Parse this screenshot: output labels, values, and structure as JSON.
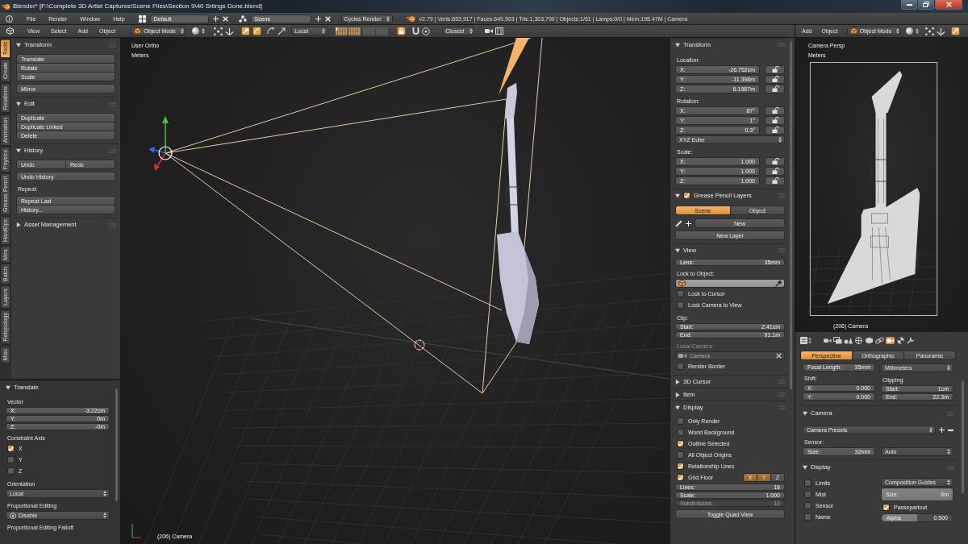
{
  "window": {
    "title": "Blender* [F:\\Complete 3D Artist Captures\\Scene Files\\Section 9\\40 Srtings Done.blend]"
  },
  "info_header": {
    "menus": [
      "File",
      "Render",
      "Window",
      "Help"
    ],
    "screen_layout": "Default",
    "scene": "Scene",
    "render_engine": "Cycles Render",
    "stats": "v2.79 | Verts:653,917 | Faces:649,903 | Tris:1,303,790 | Objects:1/61 | Lamps:0/0 | Mem:195.47M | Camera"
  },
  "viewport_header": {
    "menus": [
      "View",
      "Select",
      "Add",
      "Object"
    ],
    "mode": "Object Mode",
    "orientation": "Local",
    "snap_target": "Closest"
  },
  "camera_view_header": {
    "menus": [
      "Add",
      "Object"
    ],
    "mode": "Object Mode"
  },
  "tool_shelf": {
    "tabs": [
      {
        "label": "Tools",
        "selected": true
      },
      {
        "label": "Create",
        "selected": false
      },
      {
        "label": "Relations",
        "selected": false
      },
      {
        "label": "Animation",
        "selected": false
      },
      {
        "label": "Physics",
        "selected": false
      },
      {
        "label": "Grease Pencil",
        "selected": false
      },
      {
        "label": "HardOps",
        "selected": false
      },
      {
        "label": "Mira",
        "selected": false
      },
      {
        "label": "Batch",
        "selected": false
      },
      {
        "label": "Layers",
        "selected": false
      },
      {
        "label": "Retopology",
        "selected": false
      },
      {
        "label": "Misc",
        "selected": false
      }
    ],
    "panels": [
      {
        "title": "Transform",
        "expanded": true,
        "rows": [
          {
            "kind": "buttons",
            "labels": [
              "Translate",
              "Rotate",
              "Scale"
            ]
          },
          {
            "kind": "buttons",
            "labels": [
              "Mirror"
            ]
          }
        ]
      },
      {
        "title": "Edit",
        "expanded": true,
        "rows": [
          {
            "kind": "buttons",
            "labels": [
              "Duplicate",
              "Duplicate Linked",
              "Delete"
            ]
          }
        ]
      },
      {
        "title": "History",
        "expanded": true,
        "rows": [
          {
            "kind": "button_row",
            "labels": [
              "Undo",
              "Redo"
            ]
          },
          {
            "kind": "buttons",
            "labels": [
              "Undo History"
            ]
          },
          {
            "kind": "label",
            "text": "Repeat:"
          },
          {
            "kind": "buttons",
            "labels": [
              "Repeat Last",
              "History..."
            ]
          }
        ]
      },
      {
        "title": "Asset Management",
        "expanded": false
      }
    ]
  },
  "operator_panel": {
    "title": "Translate",
    "expanded": true,
    "rows": [
      {
        "kind": "label",
        "text": "Vector"
      },
      {
        "kind": "number",
        "label": "X:",
        "value": "-3.22cm"
      },
      {
        "kind": "number",
        "label": "Y:",
        "value": "0m"
      },
      {
        "kind": "number",
        "label": "Z:",
        "value": "-0m"
      },
      {
        "kind": "label",
        "text": "Constraint Axis"
      },
      {
        "kind": "checkbox",
        "label": "X",
        "checked": true
      },
      {
        "kind": "checkbox",
        "label": "Y",
        "checked": false
      },
      {
        "kind": "checkbox",
        "label": "Z",
        "checked": false
      },
      {
        "kind": "label",
        "text": "Orientation"
      },
      {
        "kind": "dropdown",
        "value": "Local"
      },
      {
        "kind": "label",
        "text": "Proportional Editing"
      },
      {
        "kind": "icon_dropdown",
        "value": "Disable"
      },
      {
        "kind": "label",
        "text": "Proportional Editing Falloff"
      }
    ]
  },
  "viewport": {
    "view_name": "User Ortho",
    "units": "Meters",
    "object_info": "(206) Camera"
  },
  "sidebar": {
    "panels": [
      {
        "title": "Transform",
        "expanded": true,
        "rows": [
          {
            "kind": "label",
            "text": "Location:"
          },
          {
            "kind": "number",
            "label": "X:",
            "value": "-26.752cm",
            "locked": false
          },
          {
            "kind": "number",
            "label": "Y:",
            "value": "-11.398m",
            "locked": false
          },
          {
            "kind": "number",
            "label": "Z:",
            "value": "6.1987m",
            "locked": false
          },
          {
            "kind": "label",
            "text": "Rotation:"
          },
          {
            "kind": "number",
            "label": "X:",
            "value": "87°",
            "locked": false
          },
          {
            "kind": "number",
            "label": "Y:",
            "value": "1°",
            "locked": false
          },
          {
            "kind": "number",
            "label": "Z:",
            "value": "0.3°",
            "locked": false
          },
          {
            "kind": "dropdown",
            "value": "XYZ Euler"
          },
          {
            "kind": "label",
            "text": "Scale:"
          },
          {
            "kind": "number",
            "label": "X:",
            "value": "1.000",
            "locked": false
          },
          {
            "kind": "number",
            "label": "Y:",
            "value": "1.000",
            "locked": false
          },
          {
            "kind": "number",
            "label": "Z:",
            "value": "1.000",
            "locked": false
          }
        ]
      },
      {
        "title": "Grease Pencil Layers",
        "expanded": true,
        "enabled": true,
        "rows": [
          {
            "kind": "tabs",
            "items": [
              {
                "label": "Scene",
                "selected": true
              },
              {
                "label": "Object",
                "selected": false
              }
            ]
          },
          {
            "kind": "new_row",
            "label": "New"
          },
          {
            "kind": "buttons",
            "labels": [
              "New Layer"
            ]
          }
        ]
      },
      {
        "title": "View",
        "expanded": true,
        "rows": [
          {
            "kind": "number",
            "label": "Lens:",
            "value": "35mm"
          },
          {
            "kind": "label",
            "text": "Lock to Object:",
            "disabled": false
          },
          {
            "kind": "object_picker"
          },
          {
            "kind": "checkbox",
            "label": "Lock to Cursor",
            "checked": false
          },
          {
            "kind": "checkbox",
            "label": "Lock Camera to View",
            "checked": false
          },
          {
            "kind": "label",
            "text": "Clip:",
            "disabled": false
          },
          {
            "kind": "number",
            "label": "Start:",
            "value": "2.41cm"
          },
          {
            "kind": "number",
            "label": "End:",
            "value": "91.1m"
          },
          {
            "kind": "label",
            "text": "Local Camera:",
            "disabled": true
          },
          {
            "kind": "camera_field",
            "value": "Camera",
            "disabled": true
          },
          {
            "kind": "checkbox",
            "label": "Render Border",
            "checked": false
          }
        ]
      },
      {
        "title": "3D Cursor",
        "expanded": false
      },
      {
        "title": "Item",
        "expanded": false
      },
      {
        "title": "Display",
        "expanded": true,
        "rows": [
          {
            "kind": "checkbox",
            "label": "Only Render",
            "checked": false
          },
          {
            "kind": "checkbox",
            "label": "World Background",
            "checked": false
          },
          {
            "kind": "checkbox",
            "label": "Outline Selected",
            "checked": true
          },
          {
            "kind": "checkbox",
            "label": "All Object Origins",
            "checked": false
          },
          {
            "kind": "checkbox",
            "label": "Relationship Lines",
            "checked": true
          },
          {
            "kind": "grid_floor",
            "label": "Grid Floor",
            "checked": true,
            "axes": [
              {
                "label": "X",
                "selected": true
              },
              {
                "label": "Y",
                "selected": true
              },
              {
                "label": "Z",
                "selected": false
              }
            ]
          },
          {
            "kind": "number",
            "label": "Lines:",
            "value": "16",
            "disabled": false
          },
          {
            "kind": "number",
            "label": "Scale:",
            "value": "1.000",
            "disabled": false
          },
          {
            "kind": "number",
            "label": "Subdivisions:",
            "value": "10",
            "disabled": true
          },
          {
            "kind": "buttons",
            "labels": [
              "Toggle Quad View"
            ]
          }
        ]
      }
    ]
  },
  "camera_view": {
    "view_name": "Camera Persp",
    "units": "Meters",
    "object_info": "(206) Camera"
  },
  "camera_properties": {
    "context_tabs": [
      {
        "selected": false
      },
      {
        "selected": false
      },
      {
        "selected": false
      },
      {
        "selected": false
      },
      {
        "selected": false
      },
      {
        "selected": false
      },
      {
        "selected": true
      },
      {
        "selected": false
      },
      {
        "selected": false
      }
    ],
    "lens_types": [
      {
        "label": "Perspective",
        "selected": true
      },
      {
        "label": "Orthographic",
        "selected": false
      },
      {
        "label": "Panoramic",
        "selected": false
      }
    ],
    "lens_rows": [
      {
        "kind": "columns",
        "left": [
          {
            "kind": "number",
            "label": "Focal Length:",
            "value": "35mm"
          },
          {
            "kind": "label",
            "text": "Shift:"
          },
          {
            "kind": "number",
            "label": "X:",
            "value": "0.000"
          },
          {
            "kind": "number",
            "label": "Y:",
            "value": "0.000"
          }
        ],
        "right": [
          {
            "kind": "dropdown",
            "value": "Millimeters"
          },
          {
            "kind": "label",
            "text": "Clipping:"
          },
          {
            "kind": "number",
            "label": "Start:",
            "value": "1cm"
          },
          {
            "kind": "number",
            "label": "End:",
            "value": "22.3m"
          }
        ]
      }
    ],
    "panels": [
      {
        "title": "Camera",
        "expanded": true,
        "rows": [
          {
            "kind": "preset",
            "value": "Camera Presets"
          },
          {
            "kind": "label",
            "text": "Sensor:"
          },
          {
            "kind": "columns",
            "left": [
              {
                "kind": "number",
                "label": "Size:",
                "value": "32mm"
              }
            ],
            "right": [
              {
                "kind": "dropdown",
                "value": "Auto"
              }
            ]
          }
        ]
      },
      {
        "title": "Display",
        "expanded": true,
        "rows": [
          {
            "kind": "columns",
            "left": [
              {
                "kind": "checkbox",
                "label": "Limits",
                "checked": false
              },
              {
                "kind": "checkbox",
                "label": "Mist",
                "checked": false
              },
              {
                "kind": "checkbox",
                "label": "Sensor",
                "checked": false
              },
              {
                "kind": "checkbox",
                "label": "Name",
                "checked": false
              }
            ],
            "right": [
              {
                "kind": "dropdown",
                "value": "Composition Guides"
              },
              {
                "kind": "number",
                "label": "Size:",
                "value": "6m",
                "highlighted": true
              },
              {
                "kind": "checkbox",
                "label": "Passepartout",
                "checked": true
              },
              {
                "kind": "slider",
                "label": "Alpha",
                "value": "0.500",
                "level": 0.5
              }
            ]
          }
        ]
      }
    ]
  }
}
